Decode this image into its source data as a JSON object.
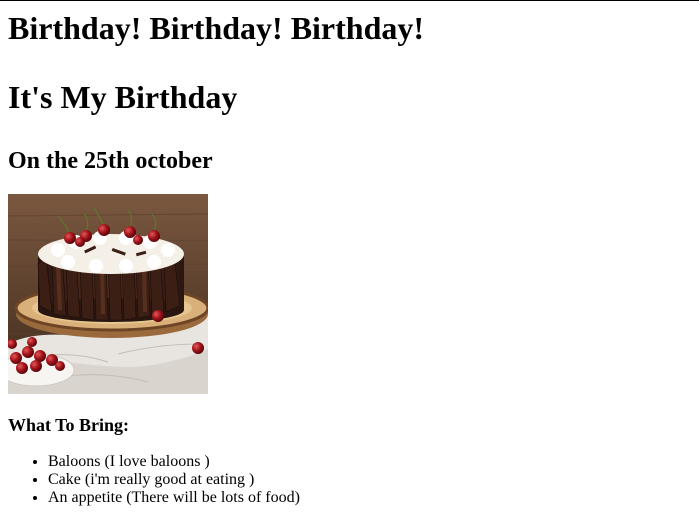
{
  "page": {
    "heading1": "Birthday! Birthday! Birthday!",
    "heading2": "It's My Birthday",
    "date_heading": "On the 25th october",
    "image_icon": "black-forest-cake-image",
    "bring_heading": "What To Bring:",
    "bring_items": [
      "Baloons (I love baloons )",
      "Cake (i'm really good at eating )",
      "An appetite (There will be lots of food)"
    ]
  }
}
